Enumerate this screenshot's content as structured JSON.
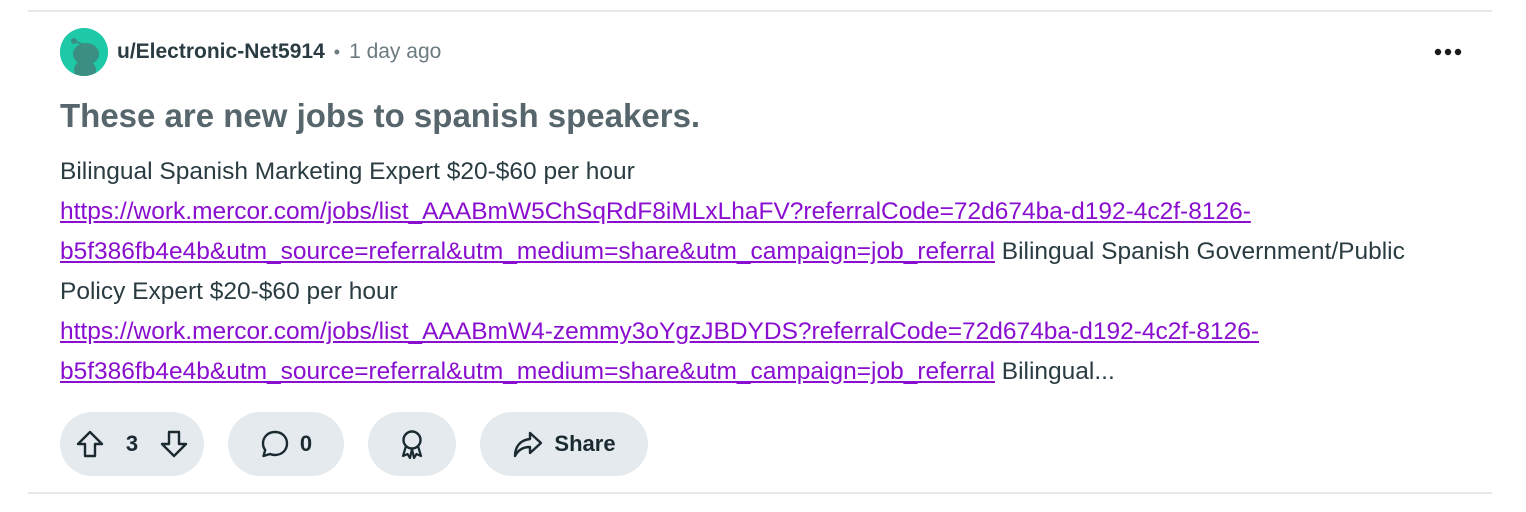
{
  "post": {
    "username": "u/Electronic-Net5914",
    "separator": "•",
    "time": "1 day ago",
    "title": "These are new jobs to spanish speakers.",
    "body": {
      "line1": "Bilingual Spanish Marketing Expert $20-$60 per hour",
      "link1": "https://work.mercor.com/jobs/list_AAABmW5ChSqRdF8iMLxLhaFV?referralCode=72d674ba-d192-4c2f-8126-b5f386fb4e4b&utm_source=referral&utm_medium=share&utm_campaign=job_referral",
      "text2": "Bilingual Spanish Government/Public Policy Expert $20-$60 per hour",
      "link2": "https://work.mercor.com/jobs/list_AAABmW4-zemmy3oYgzJBDYDS?referralCode=72d674ba-d192-4c2f-8126-b5f386fb4e4b&utm_source=referral&utm_medium=share&utm_campaign=job_referral",
      "text3": "Bilingual..."
    }
  },
  "actions": {
    "votes": "3",
    "comments": "0",
    "share_label": "Share"
  },
  "icons": {
    "avatar": "snoo-avatar-icon",
    "more": "more-options-icon",
    "upvote": "upvote-arrow-icon",
    "downvote": "downvote-arrow-icon",
    "comment": "comment-bubble-icon",
    "award": "award-icon",
    "share": "share-arrow-icon"
  },
  "colors": {
    "link": "#8a0ecf",
    "avatar_bg": "#1ec9a8",
    "pill_bg": "#e4eaed"
  }
}
